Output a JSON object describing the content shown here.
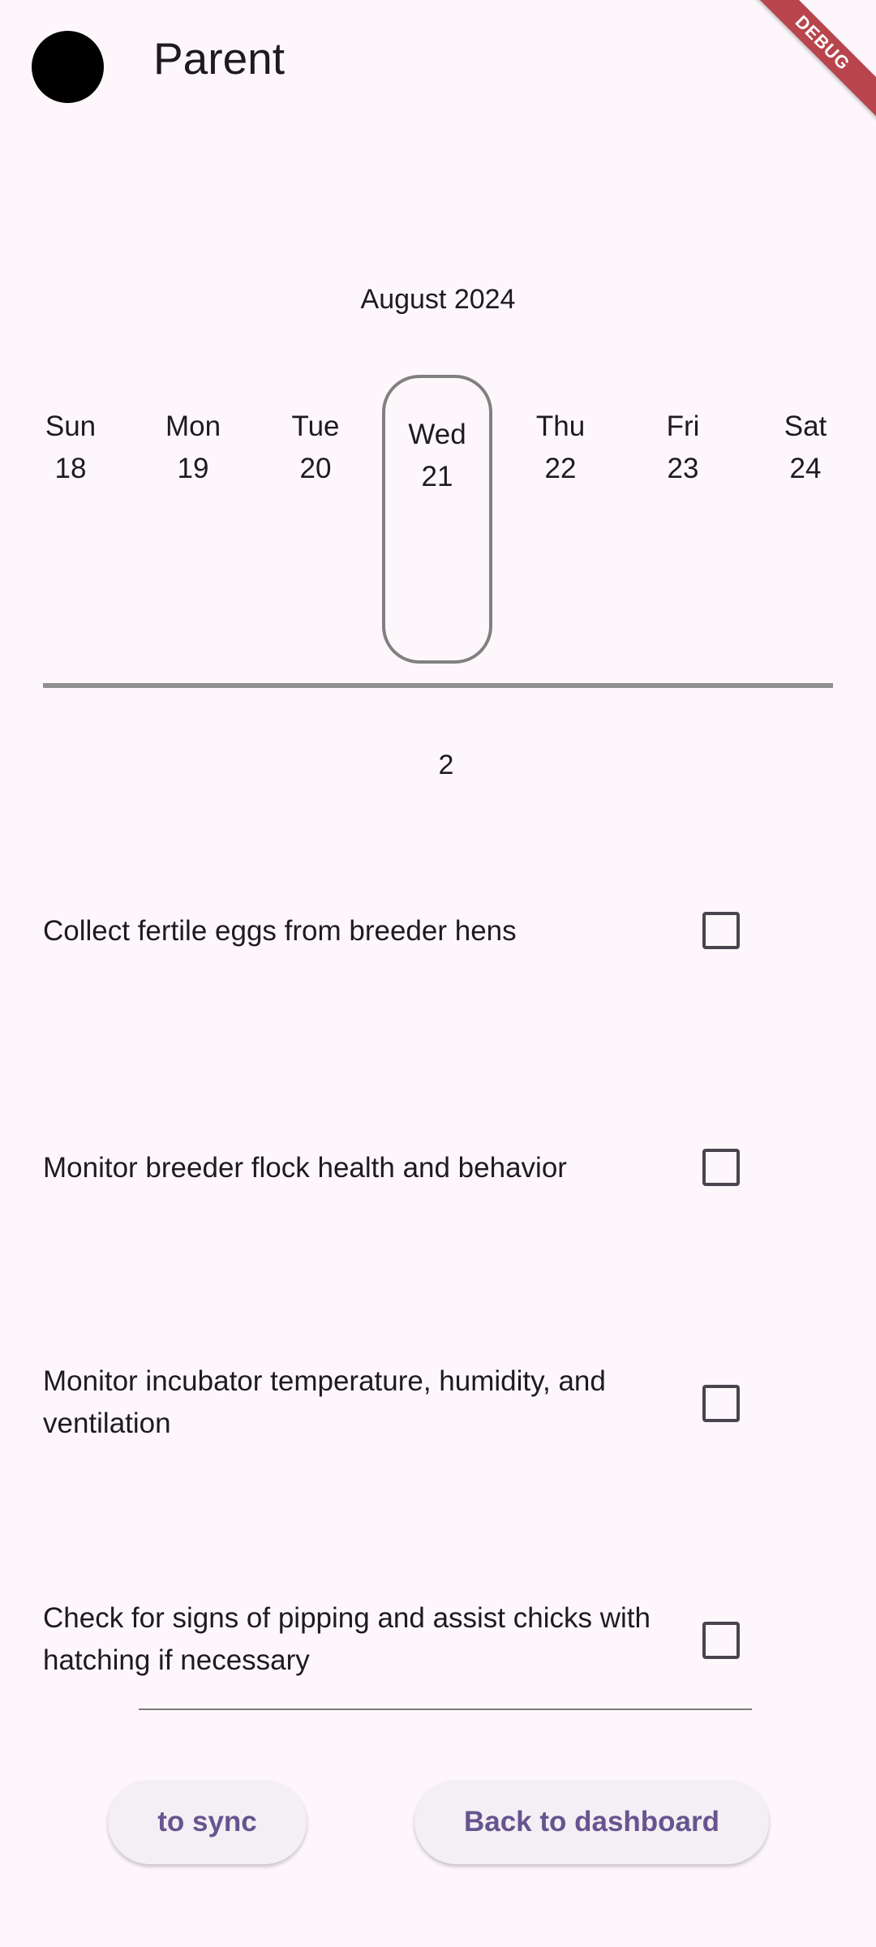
{
  "header": {
    "title": "Parent",
    "debug_label": "DEBUG"
  },
  "calendar": {
    "month_label": "August  2024",
    "selected_index": 3,
    "days": [
      {
        "weekday": "Sun",
        "date": "18"
      },
      {
        "weekday": "Mon",
        "date": "19"
      },
      {
        "weekday": "Tue",
        "date": "20"
      },
      {
        "weekday": "Wed",
        "date": "21"
      },
      {
        "weekday": "Thu",
        "date": "22"
      },
      {
        "weekday": "Fri",
        "date": "23"
      },
      {
        "weekday": "Sat",
        "date": "24"
      }
    ]
  },
  "task_count": "2",
  "tasks": [
    {
      "text": "Collect fertile eggs from breeder hens",
      "checked": false
    },
    {
      "text": "Monitor breeder flock health and behavior",
      "checked": false
    },
    {
      "text": "Monitor incubator temperature, humidity, and ventilation",
      "checked": false
    },
    {
      "text": "Check for signs of pipping and assist chicks with hatching if necessary",
      "checked": false
    }
  ],
  "buttons": {
    "sync_label": "to sync",
    "dashboard_label": "Back to dashboard"
  },
  "colors": {
    "background": "#fdf7fc",
    "button_text": "#65558f",
    "debug_banner": "#b8444c"
  }
}
